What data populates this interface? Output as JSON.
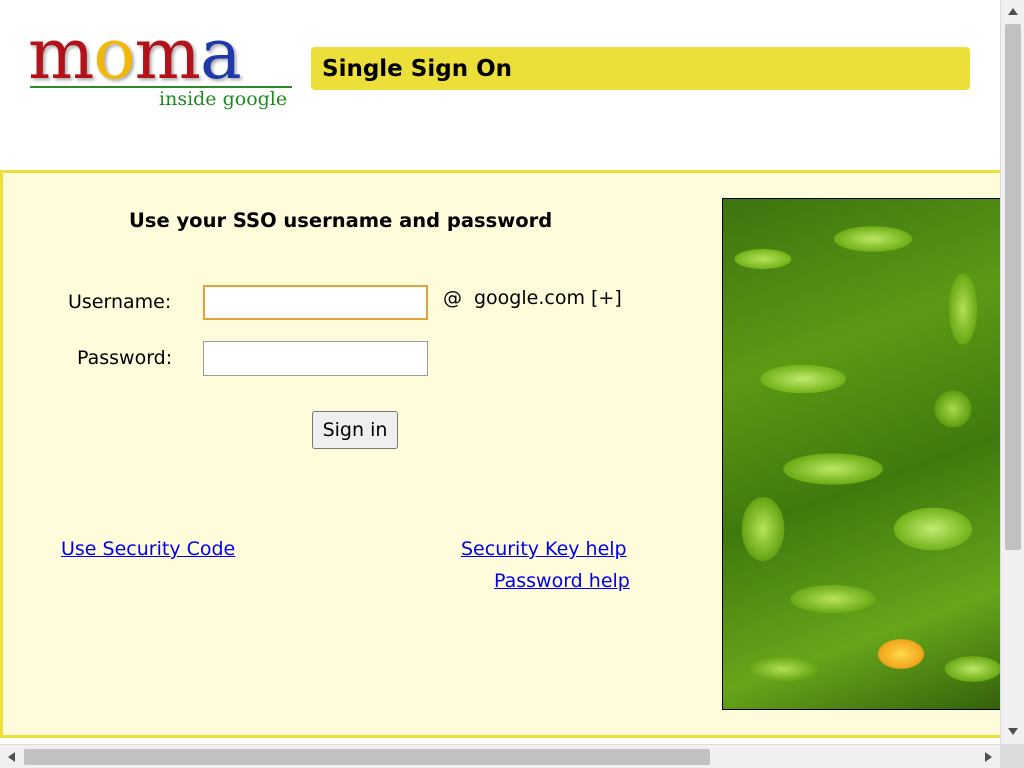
{
  "header": {
    "logo": {
      "letters": [
        "m",
        "o",
        "m",
        "a"
      ],
      "letter_colors": [
        "#b3121b",
        "#f2b807",
        "#b3121b",
        "#1d3aa8"
      ],
      "subtitle": "inside google"
    },
    "title": "Single Sign On",
    "title_bar_color": "#ecdf3a"
  },
  "login": {
    "heading": "Use your SSO username and password",
    "username_label": "Username:",
    "username_value": "",
    "password_label": "Password:",
    "password_value": "",
    "at_sign": "@",
    "domain": "google.com",
    "domain_toggle": "[+]",
    "submit_label": "Sign in"
  },
  "links": {
    "security_code": "Use Security Code",
    "security_key_help": "Security Key help",
    "password_help": "Password help"
  },
  "colors": {
    "panel_background": "#fffcdc",
    "panel_border": "#ecdf3a",
    "link": "#0000ee"
  },
  "photo": {
    "icon": "green-peppers-photo"
  }
}
